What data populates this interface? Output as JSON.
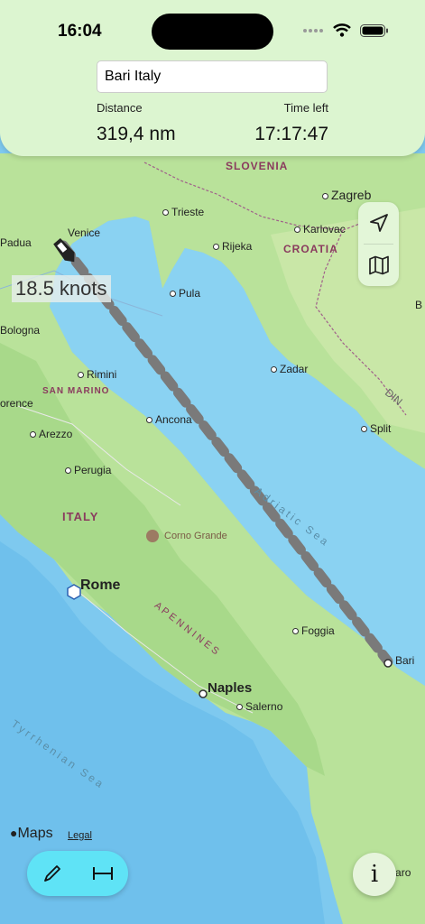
{
  "status_bar": {
    "time": "16:04"
  },
  "destination": {
    "value": "Bari Italy"
  },
  "stats": {
    "distance_label": "Distance",
    "distance_value": "319,4 nm",
    "time_label": "Time left",
    "time_value": "17:17:47"
  },
  "speed": "18.5 knots",
  "map": {
    "places": {
      "slovenia": "SLOVENIA",
      "zagreb": "Zagreb",
      "trieste": "Trieste",
      "karlovac": "Karlovac",
      "venice": "Venice",
      "padua": "Padua",
      "rijeka": "Rijeka",
      "croatia": "CROATIA",
      "pula": "Pula",
      "bologna": "Bologna",
      "rimini": "Rimini",
      "zadar": "Zadar",
      "san_marino": "SAN MARINO",
      "florence": "orence",
      "ancona": "Ancona",
      "split": "Split",
      "arezzo": "Arezzo",
      "perugia": "Perugia",
      "italy": "ITALY",
      "corno": "Corno Grande",
      "rome": "Rome",
      "foggia": "Foggia",
      "bari": "Bari",
      "apennines": "A P E N N I N E S",
      "naples": "Naples",
      "salerno": "Salerno",
      "catanzaro": "Catanzaro",
      "adriatic": "Adriatic Sea",
      "tyrrhenian": "Tyrrhenian Sea",
      "bih": "B",
      "din": "DIN"
    },
    "attribution": "Maps",
    "legal": "Legal"
  },
  "controls": {
    "locate_icon": "location-arrow-icon",
    "map_icon": "map-icon",
    "pencil_icon": "pencil-icon",
    "measure_icon": "measure-icon",
    "info_label": "i"
  },
  "colors": {
    "panel": "#dcf5d0",
    "tool_pill": "#5fe3f6",
    "route": "#7a7a7a"
  }
}
